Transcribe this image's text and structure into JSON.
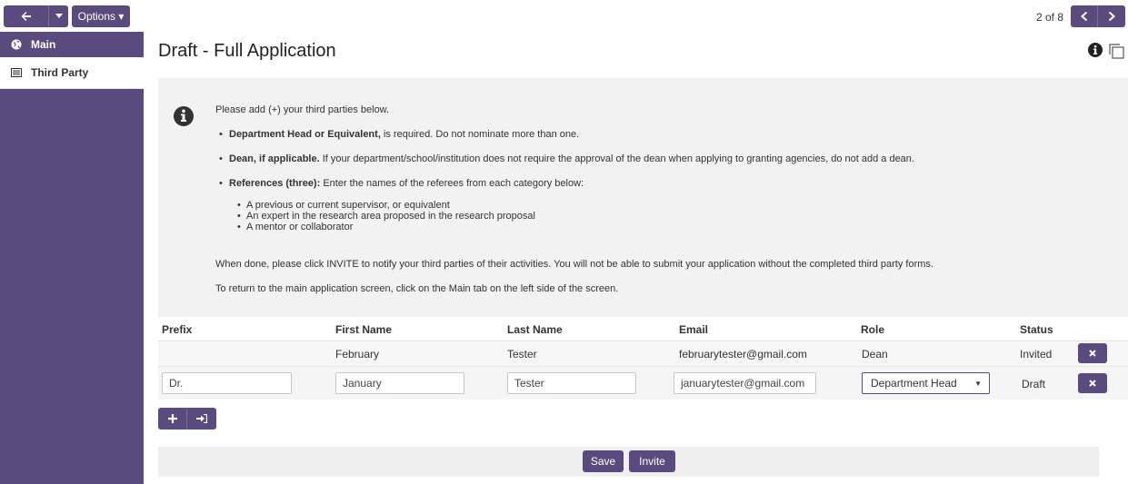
{
  "toolbar": {
    "options_label": "Options ▾",
    "pager_text": "2 of 8"
  },
  "sidebar": {
    "items": [
      {
        "label": "Main",
        "icon": "globe-icon"
      },
      {
        "label": "Third Party",
        "icon": "list-icon"
      }
    ]
  },
  "header": {
    "title": "Draft - Full Application"
  },
  "instructions": {
    "intro": "Please add (+) your third parties below.",
    "bullets": [
      {
        "bold": "Department Head or Equivalent,",
        "text": " is required. Do not nominate more than one."
      },
      {
        "bold": "Dean, if applicable.",
        "text": " If your department/school/institution does not require the approval of the dean when applying to granting agencies, do not add a dean."
      },
      {
        "bold": "References (three):",
        "text": " Enter the names of the referees from each category below:"
      }
    ],
    "sub_bullets": [
      "A previous or current supervisor, or equivalent",
      "An expert in the research area proposed in the research proposal",
      "A mentor or collaborator"
    ],
    "note1": "When done, please click INVITE to notify your third parties of their activities. You will not be able to submit your application without the completed third party forms.",
    "note2": "To return to the main application screen, click on the Main tab on the left side of the screen."
  },
  "table": {
    "headers": [
      "Prefix",
      "First Name",
      "Last Name",
      "Email",
      "Role",
      "Status"
    ],
    "rows": [
      {
        "prefix": "",
        "first": "February",
        "last": "Tester",
        "email": "februarytester@gmail.com",
        "role": "Dean",
        "status": "Invited"
      },
      {
        "prefix": "Dr.",
        "first": "January",
        "last": "Tester",
        "email": "januarytester@gmail.com",
        "role": "Department Head",
        "status": "Draft"
      }
    ]
  },
  "footer": {
    "save_label": "Save",
    "invite_label": "Invite"
  },
  "colors": {
    "accent": "#5b4a7e",
    "panel_bg": "#f2f2f2"
  }
}
